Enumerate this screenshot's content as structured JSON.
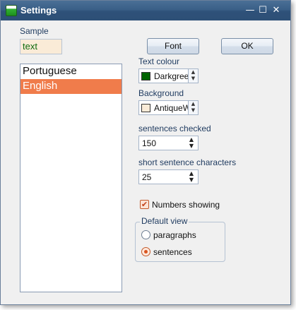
{
  "window": {
    "title": "Settings",
    "icon": "app-icon",
    "controls": {
      "minimize": "—",
      "maximize": "☐",
      "close": "✕"
    }
  },
  "sample": {
    "label": "Sample",
    "value": "text",
    "text_color": "#0e6b0e",
    "background_color": "#faebd7"
  },
  "languages": {
    "items": [
      "Portuguese",
      "English"
    ],
    "selected": "English",
    "selected_color": "#f07c4b"
  },
  "buttons": {
    "font": "Font",
    "ok": "OK"
  },
  "text_colour": {
    "label": "Text colour",
    "value": "Darkgreen",
    "swatch": "#006400"
  },
  "background": {
    "label": "Background",
    "value": "AntiqueWhite",
    "swatch": "#faebd7"
  },
  "sentences_checked": {
    "label": "sentences checked",
    "value": "150"
  },
  "short_sentence_characters": {
    "label": "short sentence characters",
    "value": "25"
  },
  "numbers_showing": {
    "label": "Numbers showing",
    "checked": true
  },
  "default_view": {
    "legend": "Default view",
    "options": [
      "paragraphs",
      "sentences"
    ],
    "selected": "sentences"
  },
  "accent_color": "#f07c4b"
}
